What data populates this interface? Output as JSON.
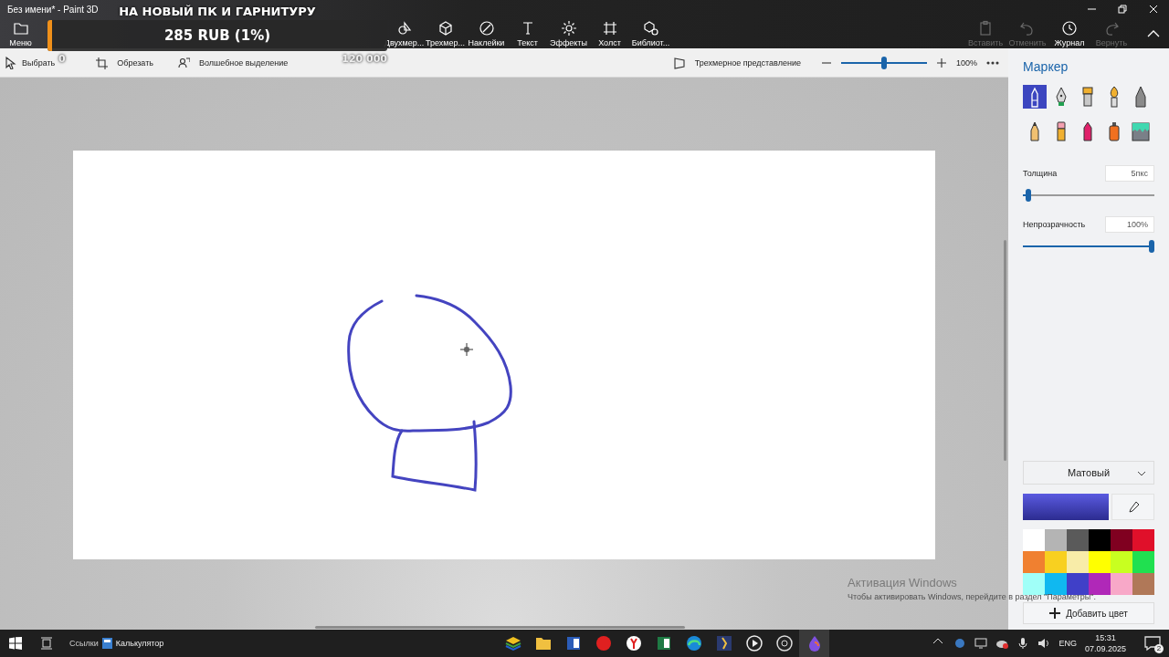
{
  "window": {
    "title": "Без имени* - Paint 3D"
  },
  "ribbon": {
    "menu": {
      "label": "Меню"
    },
    "tools": [
      {
        "label": "Двухмер..."
      },
      {
        "label": "Трехмер..."
      },
      {
        "label": "Наклейки"
      },
      {
        "label": "Текст"
      },
      {
        "label": "Эффекты"
      },
      {
        "label": "Холст"
      },
      {
        "label": "Библиот..."
      }
    ],
    "actions": [
      {
        "label": "Вставить",
        "disabled": true
      },
      {
        "label": "Отменить",
        "disabled": true
      },
      {
        "label": "Журнал",
        "disabled": false
      },
      {
        "label": "Вернуть",
        "disabled": true
      }
    ]
  },
  "toolbar": {
    "tools": [
      {
        "label": "Выбрать"
      },
      {
        "label": "Обрезать"
      },
      {
        "label": "Волшебное выделение"
      }
    ],
    "view_3d": "Трехмерное представление",
    "zoom": {
      "level": 0.5,
      "reading": "100%"
    }
  },
  "panel": {
    "title": "Маркер",
    "brushes": [
      {
        "selected": true
      },
      {
        "selected": false
      },
      {
        "selected": false
      },
      {
        "selected": false
      },
      {
        "selected": false
      },
      {
        "selected": false
      },
      {
        "selected": false
      },
      {
        "selected": false
      },
      {
        "selected": false
      },
      {
        "selected": false
      }
    ],
    "thickness": {
      "label": "Толщина",
      "value": "5пкс",
      "level": 0.02
    },
    "opacity": {
      "label": "Непрозрачность",
      "value": "100%",
      "level": 1
    },
    "finish": "Матовый",
    "palette": [
      {
        "color": "#ffffff"
      },
      {
        "color": "#b4b4b4"
      },
      {
        "color": "#5a5a5a"
      },
      {
        "color": "#000000"
      },
      {
        "color": "#800020"
      },
      {
        "color": "#e0102a"
      },
      {
        "color": "#f08030"
      },
      {
        "color": "#f8d020"
      },
      {
        "color": "#f8eca8"
      },
      {
        "color": "#ffff00"
      },
      {
        "color": "#c8ff20"
      },
      {
        "color": "#20e050"
      },
      {
        "color": "#a0fff8"
      },
      {
        "color": "#10b8f0"
      },
      {
        "color": "#4040c8"
      },
      {
        "color": "#b028b8"
      },
      {
        "color": "#f8a8c8"
      },
      {
        "color": "#b07858"
      }
    ],
    "add_color": "Добавить цвет"
  },
  "overlay": {
    "title": "НА НОВЫЙ ПК И ГАРНИТУРУ",
    "amount": "285 RUB (1%)",
    "level": 0.01,
    "min": "0",
    "max": "120 000"
  },
  "activation": {
    "title": "Активация Windows",
    "text": "Чтобы активировать Windows, перейдите в раздел \"Параметры\"."
  },
  "taskbar": {
    "links": "Ссылки",
    "pinned": "Калькулятор",
    "apps": [
      {
        "selected": false
      },
      {
        "selected": false
      },
      {
        "selected": false
      },
      {
        "selected": false
      },
      {
        "selected": false
      },
      {
        "selected": false
      },
      {
        "selected": false
      },
      {
        "selected": false
      },
      {
        "selected": false
      },
      {
        "selected": false
      },
      {
        "selected": true
      }
    ],
    "language": "ENG",
    "time": "15:31",
    "date": "07.09.2025",
    "notifications": "2"
  }
}
